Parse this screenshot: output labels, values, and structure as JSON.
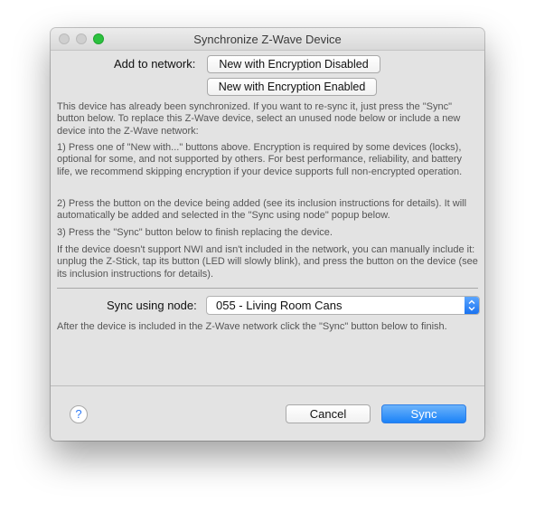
{
  "window": {
    "title": "Synchronize Z-Wave Device"
  },
  "add_to_network": {
    "label": "Add to network:",
    "button_disabled": "New with Encryption Disabled",
    "button_enabled": "New with Encryption Enabled"
  },
  "instructions": {
    "intro": "This device has already been synchronized. If you want to re-sync it, just press the \"Sync\" button below. To replace this Z-Wave device, select an unused node below or include a new device into the Z-Wave network:",
    "step1": "1) Press one of \"New with...\" buttons above. Encryption is required by some devices (locks), optional for some, and not supported by others. For best performance, reliability, and battery life, we recommend skipping encryption if your device supports full non-encrypted operation.",
    "step2": "2) Press the button on the device being added (see its inclusion instructions for details). It will automatically be added and selected in the \"Sync using node\" popup below.",
    "step3": "3) Press the \"Sync\" button below to finish replacing the device.",
    "nwi": "If the device doesn't support NWI and isn't included in the network, you can manually include it: unplug the Z-Stick, tap its button (LED will slowly blink), and press the button on the device (see its inclusion instructions for details)."
  },
  "sync_node": {
    "label": "Sync using node:",
    "selected": "055 - Living Room Cans"
  },
  "after_note": "After the device is included in the Z-Wave network click the \"Sync\" button below to finish.",
  "footer": {
    "help_label": "?",
    "cancel_label": "Cancel",
    "sync_label": "Sync"
  },
  "colors": {
    "accent": "#1b82f8",
    "window_bg": "#e3e3e3",
    "zoom_button": "#2cc13f"
  }
}
